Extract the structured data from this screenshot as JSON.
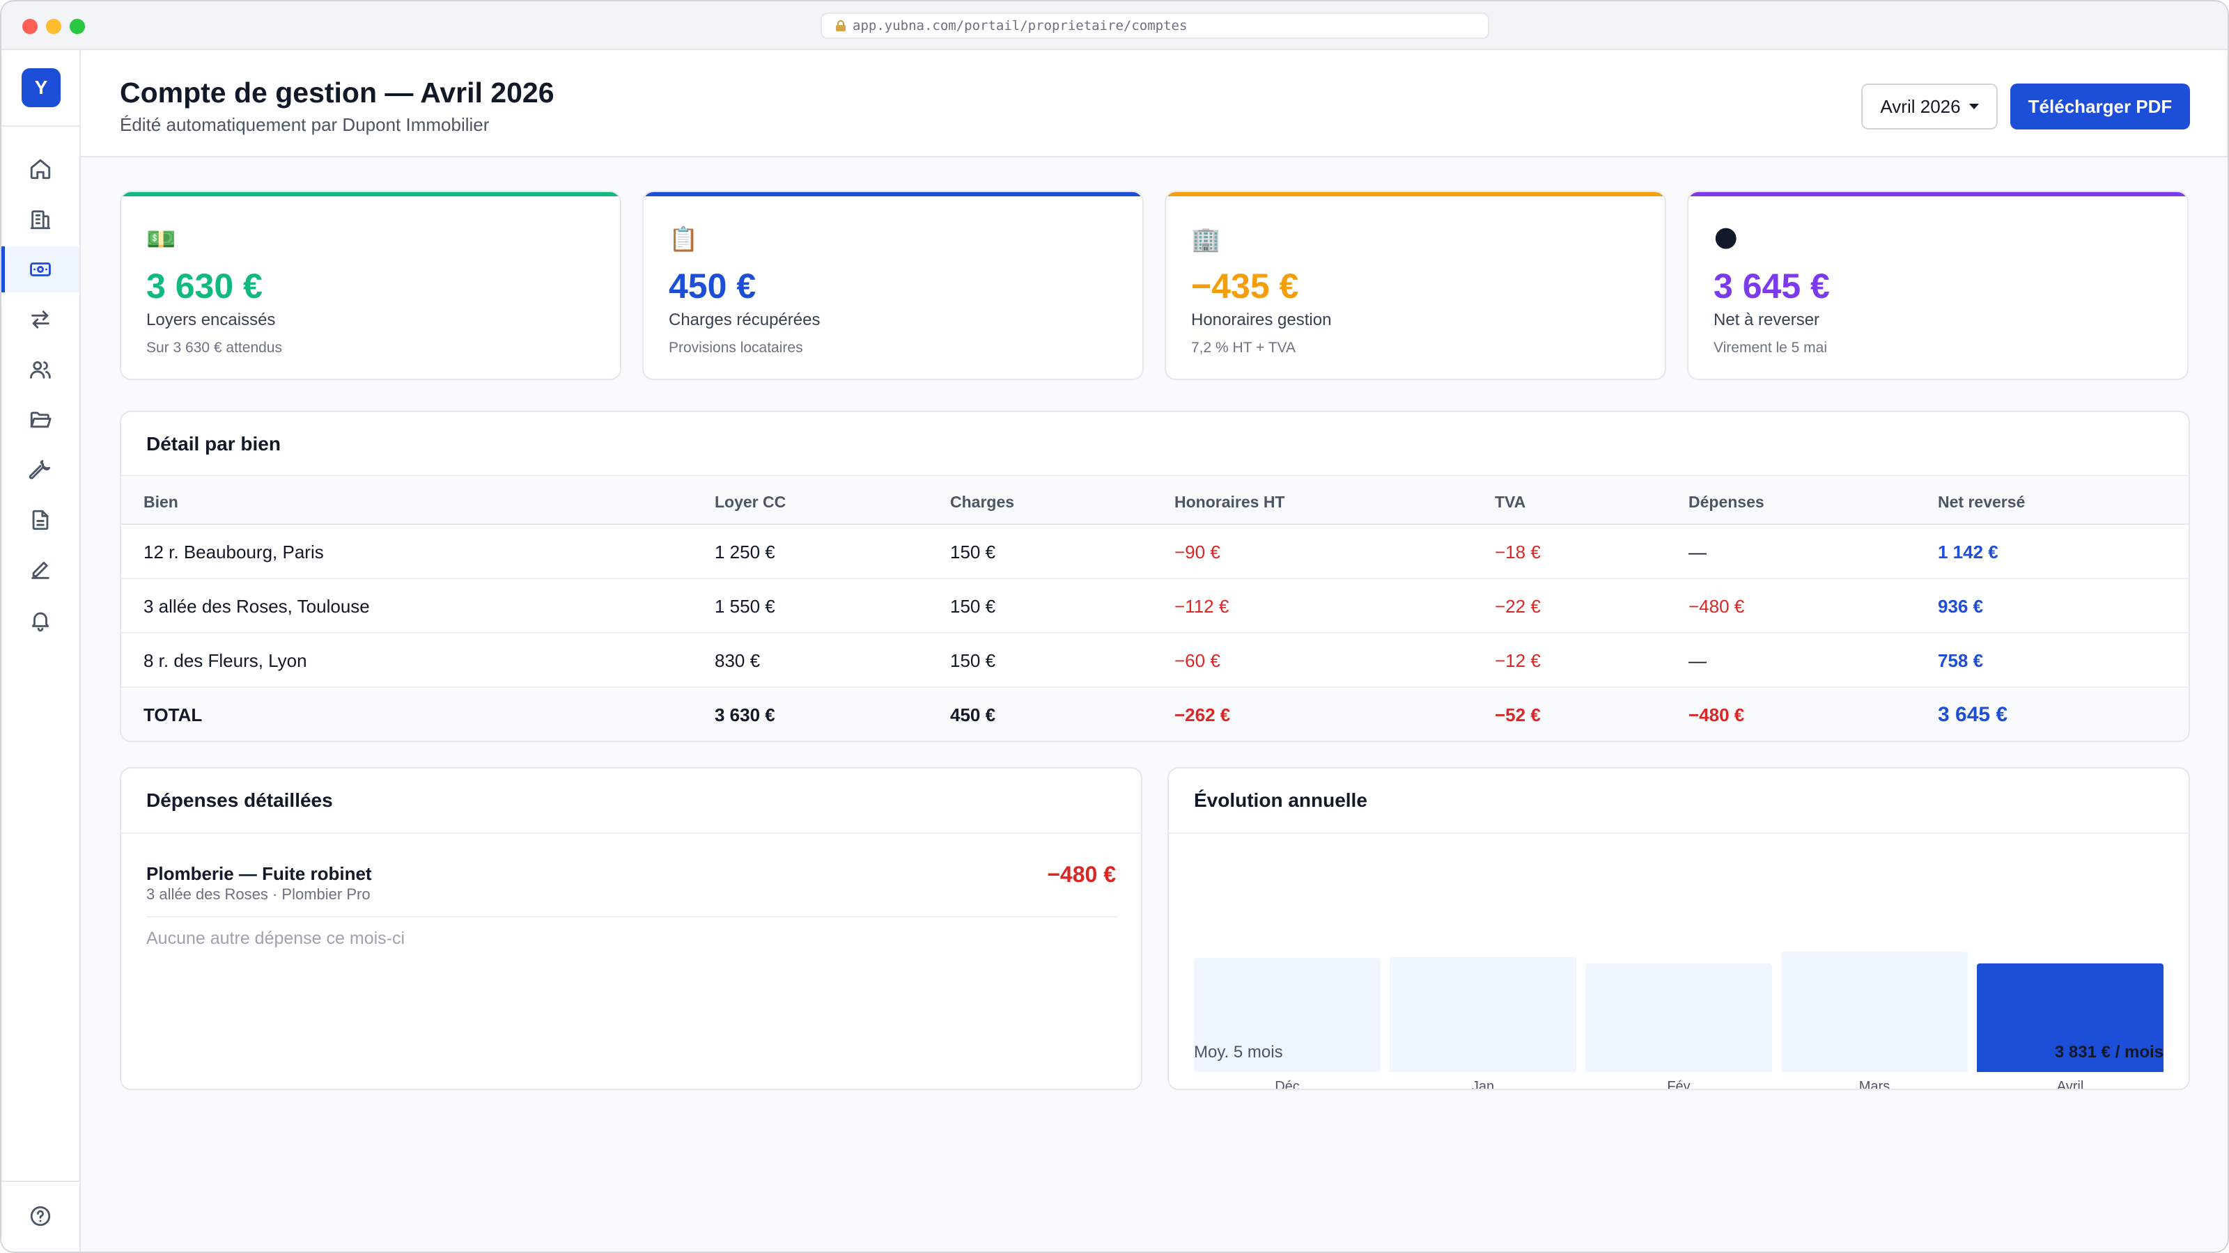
{
  "browser": {
    "url": "app.yubna.com/portail/proprietaire/comptes"
  },
  "sidebar": {
    "logo": "Y",
    "items": [
      {
        "name": "home",
        "icon": "home-icon"
      },
      {
        "name": "buildings",
        "icon": "building-icon"
      },
      {
        "name": "accounts",
        "icon": "money-icon",
        "active": true
      },
      {
        "name": "transfers",
        "icon": "arrows-icon"
      },
      {
        "name": "tenants",
        "icon": "users-icon"
      },
      {
        "name": "documents",
        "icon": "folder-icon"
      },
      {
        "name": "maintenance",
        "icon": "wrench-icon"
      },
      {
        "name": "reports",
        "icon": "file-icon"
      },
      {
        "name": "signatures",
        "icon": "pen-icon"
      },
      {
        "name": "notifications",
        "icon": "bell-icon"
      }
    ],
    "help_icon": "help-icon"
  },
  "header": {
    "title": "Compte de gestion — Avril 2026",
    "subtitle": "Édité automatiquement par Dupont Immobilier",
    "period": "Avril 2026",
    "download_label": "Télécharger PDF"
  },
  "kpis": [
    {
      "emoji": "💵",
      "value": "3 630 €",
      "label": "Loyers encaissés",
      "note": "Sur 3 630 € attendus",
      "color": "#10b981"
    },
    {
      "emoji": "📋",
      "value": "450 €",
      "label": "Charges récupérées",
      "note": "Provisions locataires",
      "color": "#1d4ed8"
    },
    {
      "emoji": "🏢",
      "value": "−435 €",
      "label": "Honoraires gestion",
      "note": "7,2 % HT + TVA",
      "color": "#f59e0b"
    },
    {
      "emoji": "🌑",
      "value": "3 645 €",
      "label": "Net à reverser",
      "note": "Virement le 5 mai",
      "color": "#7c3aed"
    }
  ],
  "table": {
    "title": "Détail par bien",
    "columns": [
      "Bien",
      "Loyer CC",
      "Charges",
      "Honoraires HT",
      "TVA",
      "Dépenses",
      "Net reversé"
    ],
    "rows": [
      [
        "12 r. Beaubourg, Paris",
        "1 250 €",
        "150 €",
        "−90 €",
        "−18 €",
        "—",
        "1 142 €"
      ],
      [
        "3 allée des Roses, Toulouse",
        "1 550 €",
        "150 €",
        "−112 €",
        "−22 €",
        "−480 €",
        "936 €"
      ],
      [
        "8 r. des Fleurs, Lyon",
        "830 €",
        "150 €",
        "−60 €",
        "−12 €",
        "—",
        "758 €"
      ]
    ],
    "total": [
      "TOTAL",
      "3 630 €",
      "450 €",
      "−262 €",
      "−52 €",
      "−480 €",
      "3 645 €"
    ]
  },
  "expenses": {
    "title": "Dépenses détaillées",
    "item_title": "Plomberie — Fuite robinet",
    "item_sub": "3 allée des Roses · Plombier Pro",
    "item_amount": "−480 €",
    "empty_text": "Aucune autre dépense ce mois-ci"
  },
  "evolution": {
    "title": "Évolution annuelle",
    "avg_label": "Moy. 5 mois",
    "avg_value": "3 831 € / mois"
  },
  "chart_data": {
    "type": "bar",
    "title": "Évolution annuelle",
    "categories": [
      "Déc",
      "Jan",
      "Fév",
      "Mars",
      "Avril"
    ],
    "values": [
      3840,
      3870,
      3660,
      4060,
      3645
    ],
    "ylim": [
      0,
      4400
    ],
    "highlight_index": 4,
    "highlight_color": "#1d4ed8",
    "base_color": "#eff6ff",
    "grid": false
  }
}
